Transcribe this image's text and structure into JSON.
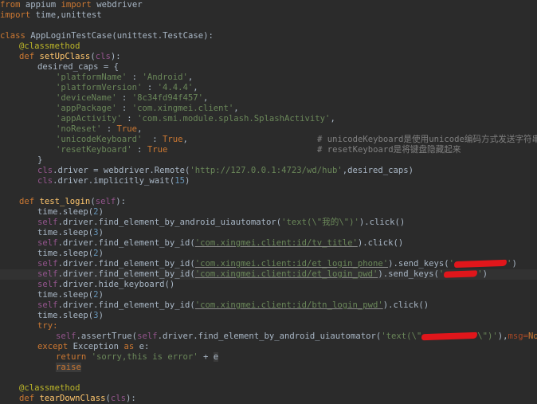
{
  "code": {
    "l1": [
      "from",
      " appium ",
      "import",
      " webdriver"
    ],
    "l2": [
      "import",
      " time,unittest"
    ],
    "l4": [
      "class",
      " AppLoginTestCase(unittest.TestCase):"
    ],
    "l5": "@classmethod",
    "l6": [
      "def",
      " ",
      "setUpClass",
      "(",
      "cls",
      "):"
    ],
    "l7": "desired_caps = {",
    "caps": [
      {
        "k": "'platformName'",
        "sep": " : ",
        "v": "'Android'",
        "end": ","
      },
      {
        "k": "'platformVersion'",
        "sep": " : ",
        "v": "'4.4.4'",
        "end": ","
      },
      {
        "k": "'deviceName'",
        "sep": " : ",
        "v": "'8c34fd94f457'",
        "end": ","
      },
      {
        "k": "'appPackage'",
        "sep": " : ",
        "v": "'com.xingmei.client'",
        "end": ","
      },
      {
        "k": "'appActivity'",
        "sep": " : ",
        "v": "'com.smi.module.splash.SplashActivity'",
        "end": ","
      },
      {
        "k": "'noReset'",
        "sep": " : ",
        "v": "True",
        "end": ","
      },
      {
        "k": "'unicodeKeyboard'",
        "sep": "  : ",
        "v": "True",
        "end": ","
      },
      {
        "k": "'resetKeyboard'",
        "sep": " : ",
        "v": "True",
        "end": ""
      }
    ],
    "cmt1": "# unicodeKeyboard是使用unicode编码方式发送字符串",
    "cmt2": "# resetKeyboard是将键盘隐藏起来",
    "close_brace": "}",
    "l17": [
      "cls",
      ".driver = webdriver.Remote(",
      "'http://127.0.0.1:4723/wd/hub'",
      ",desired_caps)"
    ],
    "l18": [
      "cls",
      ".driver.implicitly_wait(",
      "15",
      ")"
    ],
    "l20": [
      "def",
      " ",
      "test_login",
      "(",
      "self",
      "):"
    ],
    "sleep": "time.sleep(",
    "two": "2",
    "three": "3",
    "close_paren": ")",
    "self": "self",
    "l22a": ".driver.find_element_by_android_uiautomator(",
    "l22b": "'text(\\\"我的\\\")'",
    "l22c": ").click()",
    "by_id": ".driver.find_element_by_id(",
    "tv_title": "'com.xingmei.client:id/tv_title'",
    "click": ").click()",
    "et_phone": "'com.xingmei.client:id/et_login_phone'",
    "send_keys": ").send_keys(",
    "tick": "'",
    "et_pwd": "'com.xingmei.client:id/et_login_pwd'",
    "hide_kb": ".driver.hide_keyboard()",
    "btn_pwd": "'com.xingmei.client:id/btn_login_pwd'",
    "try": "try:",
    "assert_a": ".assertTrue(",
    "assert_b": ".driver.find_element_by_android_uiautomator(",
    "assert_c": "'text(\\\"",
    "assert_d": "\\\")'",
    "assert_e": "),",
    "msg": "msg=",
    "none": "None",
    "except": [
      "except",
      " Exception ",
      "as",
      " e:"
    ],
    "ret": [
      "return",
      " ",
      "'sorry,this is error'",
      " + ",
      "e"
    ],
    "raise": "raise",
    "l36": "@classmethod",
    "l37": [
      "def",
      " ",
      "tearDownClass",
      "(",
      "cls",
      "):"
    ]
  }
}
